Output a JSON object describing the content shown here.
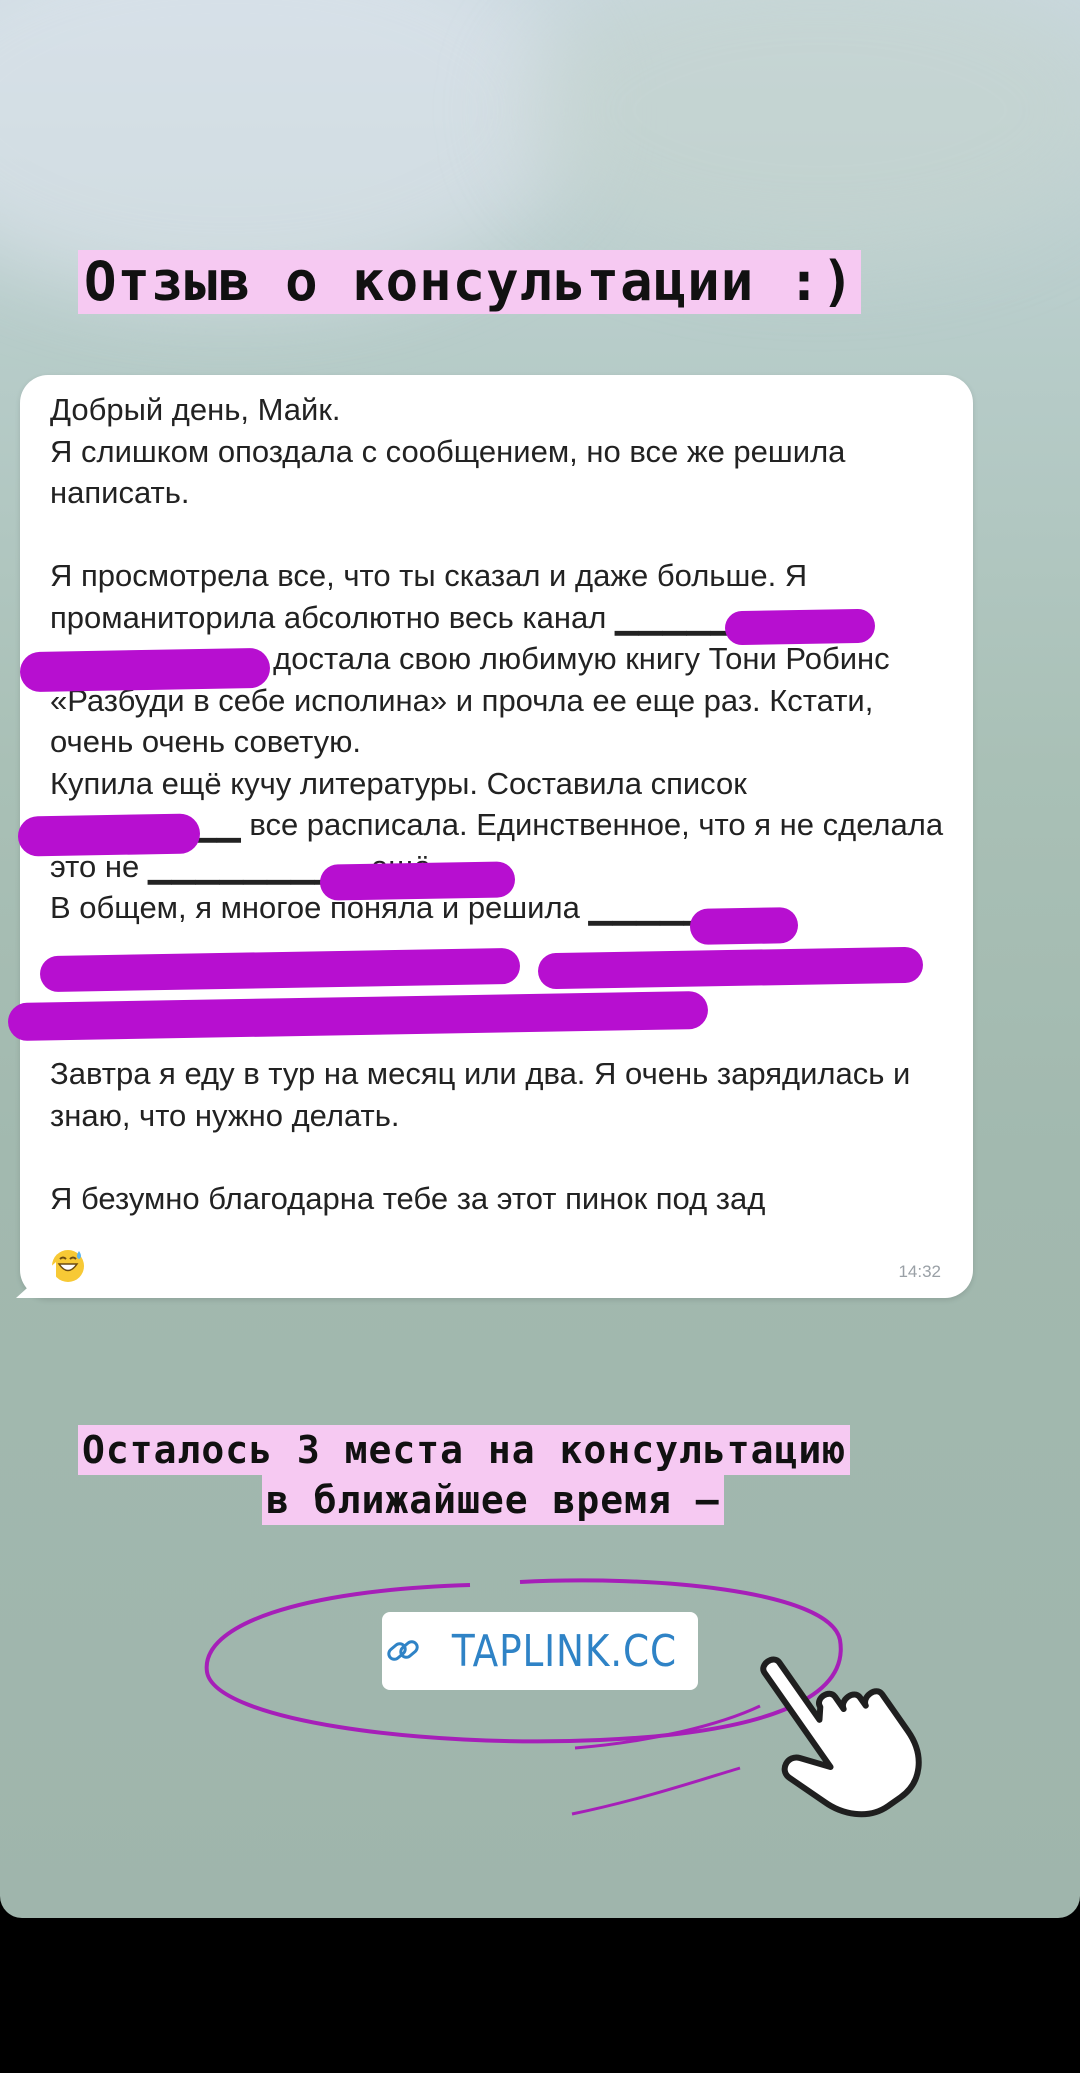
{
  "story": {
    "title": "Отзыв о консультации :)",
    "message": {
      "text": "Добрый день, Майк.\nЯ слишком опоздала с сообщением, но все же решила написать.\n\nЯ просмотрела все, что ты сказал и даже больше. Я проманиторила абсолютно весь канал ▁▁▁▁▁▁\n▁▁▁▁▁▁▁▁▁ достала свою любимую книгу Тони Робинс «Разбуди в себе исполина» и прочла ее еще раз. Кстати, очень очень советую.\nКупила ещё кучу литературы. Составила список\n▁▁▁▁▁▁▁▁ все расписала. Единственное, что я не сделала это не ▁▁▁▁▁▁▁▁▁ ещё.\nВ общем, я многое поняла и решила ▁▁▁▁▁\n\n\n\nЗавтра я еду в тур на месяц или два. Я очень зарядилась и знаю, что нужно делать.\n\nЯ безумно благодарна тебе за этот пинок под зад",
      "time": "14:32",
      "emoji": "grinning-sweat-emoji"
    },
    "cta_line1": "Осталось 3 места на консультацию",
    "cta_line2": "в ближайшее время —",
    "link": {
      "icon": "link-icon",
      "label": "TAPLINK.CC"
    },
    "colors": {
      "highlight": "#f6c9f2",
      "redaction": "#b70fd0",
      "link": "#2f83c6",
      "pointer_icon": "hand-pointer-icon"
    }
  }
}
